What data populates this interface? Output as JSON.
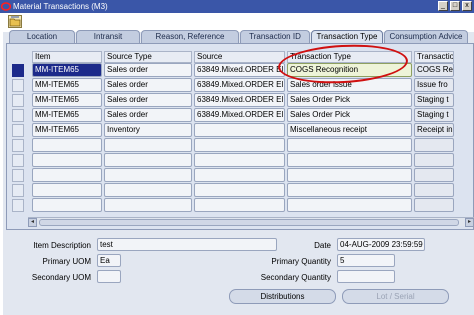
{
  "window": {
    "title": "Material Transactions (M3)",
    "controls": [
      "_",
      "□",
      "x"
    ]
  },
  "tabs": [
    {
      "label": "Location"
    },
    {
      "label": "Intransit"
    },
    {
      "label": "Reason, Reference"
    },
    {
      "label": "Transaction ID"
    },
    {
      "label": "Transaction Type",
      "active": true
    },
    {
      "label": "Consumption Advice"
    }
  ],
  "grid": {
    "headers": [
      "Item",
      "Source Type",
      "Source",
      "Transaction Type",
      "Transactio"
    ],
    "rows": [
      {
        "item": "MM-ITEM65",
        "source_type": "Sales order",
        "source": "63849.Mixed.ORDER El",
        "transaction_type": "COGS Recognition",
        "transaction": "COGS Re"
      },
      {
        "item": "MM-ITEM65",
        "source_type": "Sales order",
        "source": "63849.Mixed.ORDER El",
        "transaction_type": "Sales order issue",
        "transaction": "Issue fro"
      },
      {
        "item": "MM-ITEM65",
        "source_type": "Sales order",
        "source": "63849.Mixed.ORDER El",
        "transaction_type": "Sales Order Pick",
        "transaction": "Staging t"
      },
      {
        "item": "MM-ITEM65",
        "source_type": "Sales order",
        "source": "63849.Mixed.ORDER El",
        "transaction_type": "Sales Order Pick",
        "transaction": "Staging t"
      },
      {
        "item": "MM-ITEM65",
        "source_type": "Inventory",
        "source": "",
        "transaction_type": "Miscellaneous receipt",
        "transaction": "Receipt in"
      },
      {
        "item": "",
        "source_type": "",
        "source": "",
        "transaction_type": "",
        "transaction": ""
      },
      {
        "item": "",
        "source_type": "",
        "source": "",
        "transaction_type": "",
        "transaction": ""
      },
      {
        "item": "",
        "source_type": "",
        "source": "",
        "transaction_type": "",
        "transaction": ""
      },
      {
        "item": "",
        "source_type": "",
        "source": "",
        "transaction_type": "",
        "transaction": ""
      },
      {
        "item": "",
        "source_type": "",
        "source": "",
        "transaction_type": "",
        "transaction": ""
      }
    ],
    "hscroll": {
      "left": "◂",
      "right": "▸"
    }
  },
  "details": {
    "item_description_label": "Item Description",
    "item_description": "test",
    "date_label": "Date",
    "date": "04-AUG-2009 23:59:59",
    "primary_uom_label": "Primary UOM",
    "primary_uom": "Ea",
    "primary_quantity_label": "Primary Quantity",
    "primary_quantity": "5",
    "secondary_uom_label": "Secondary UOM",
    "secondary_uom": "",
    "secondary_quantity_label": "Secondary Quantity",
    "secondary_quantity": ""
  },
  "buttons": {
    "distributions": "Distributions",
    "lot_serial": "Lot / Serial"
  },
  "colors": {
    "titlebar": "#3a56a8",
    "annotation": "#d01010",
    "record_indicator": "#1c2a8a"
  }
}
